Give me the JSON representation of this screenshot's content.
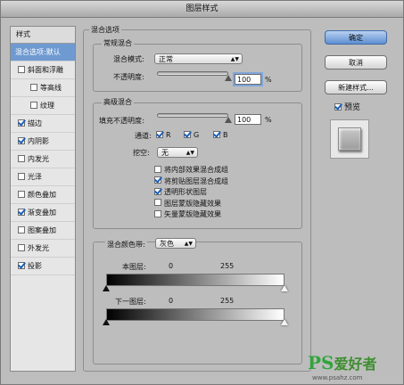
{
  "title": "图层样式",
  "left_panel": {
    "header": "样式",
    "items": [
      {
        "label": "混合选项:默认",
        "checkbox": false,
        "checked": false,
        "selected": true,
        "indent": false
      },
      {
        "label": "斜面和浮雕",
        "checkbox": true,
        "checked": false,
        "selected": false,
        "indent": false
      },
      {
        "label": "等高线",
        "checkbox": true,
        "checked": false,
        "selected": false,
        "indent": true
      },
      {
        "label": "纹理",
        "checkbox": true,
        "checked": false,
        "selected": false,
        "indent": true
      },
      {
        "label": "描边",
        "checkbox": true,
        "checked": true,
        "selected": false,
        "indent": false
      },
      {
        "label": "内阴影",
        "checkbox": true,
        "checked": true,
        "selected": false,
        "indent": false
      },
      {
        "label": "内发光",
        "checkbox": true,
        "checked": false,
        "selected": false,
        "indent": false
      },
      {
        "label": "光泽",
        "checkbox": true,
        "checked": false,
        "selected": false,
        "indent": false
      },
      {
        "label": "颜色叠加",
        "checkbox": true,
        "checked": false,
        "selected": false,
        "indent": false
      },
      {
        "label": "渐变叠加",
        "checkbox": true,
        "checked": true,
        "selected": false,
        "indent": false
      },
      {
        "label": "图案叠加",
        "checkbox": true,
        "checked": false,
        "selected": false,
        "indent": false
      },
      {
        "label": "外发光",
        "checkbox": true,
        "checked": false,
        "selected": false,
        "indent": false
      },
      {
        "label": "投影",
        "checkbox": true,
        "checked": true,
        "selected": false,
        "indent": false
      }
    ]
  },
  "blend_options": {
    "section_title": "混合选项",
    "general": {
      "title": "常规混合",
      "blend_mode_label": "混合模式:",
      "blend_mode_value": "正常",
      "opacity_label": "不透明度:",
      "opacity_value": "100",
      "opacity_unit": "%",
      "opacity_level": 1.0
    },
    "advanced": {
      "title": "高级混合",
      "fill_opacity_label": "填充不透明度:",
      "fill_opacity_value": "100",
      "fill_opacity_unit": "%",
      "fill_opacity_level": 1.0,
      "channels_label": "通道:",
      "channels": [
        {
          "label": "R",
          "checked": true
        },
        {
          "label": "G",
          "checked": true
        },
        {
          "label": "B",
          "checked": true
        }
      ],
      "knockout_label": "挖空:",
      "knockout_value": "无",
      "options": [
        {
          "label": "将内部效果混合成组",
          "checked": false
        },
        {
          "label": "将剪贴图层混合成组",
          "checked": true
        },
        {
          "label": "透明形状图层",
          "checked": true
        },
        {
          "label": "图层蒙版隐藏效果",
          "checked": false
        },
        {
          "label": "矢量蒙版隐藏效果",
          "checked": false
        }
      ]
    },
    "blend_if": {
      "label": "混合颜色带:",
      "value": "灰色",
      "this_layer_label": "本图层:",
      "this_layer_min": "0",
      "this_layer_max": "255",
      "underlying_label": "下一图层:",
      "underlying_min": "0",
      "underlying_max": "255"
    }
  },
  "buttons": {
    "ok": "确定",
    "cancel": "取消",
    "new_style": "新建样式...",
    "preview_label": "预览",
    "preview_checked": true
  },
  "watermark": {
    "logo": "PS",
    "text": "爱好者",
    "url": "www.psahz.com"
  },
  "colors": {
    "window_bg": "#bdbdbd",
    "selected_item": "#6f9ad1",
    "checkmark": "#1c5fb5",
    "watermark": "#2fa53c"
  }
}
